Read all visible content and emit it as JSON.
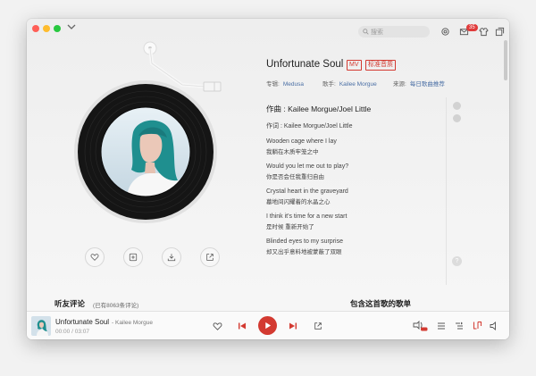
{
  "toolbar": {
    "search_placeholder": "搜索",
    "message_badge": "35"
  },
  "song": {
    "title": "Unfortunate Soul",
    "tag_mv": "MV",
    "tag_quality": "标准音质",
    "album_label": "专辑:",
    "album_value": "Medusa",
    "artist_label": "歌手:",
    "artist_value": "Kailee Morgue",
    "source_label": "来源:",
    "source_value": "每日歌曲推荐"
  },
  "lyrics": {
    "composer": "作曲 : Kailee Morgue/Joel Little",
    "lyricist": "作词 : Kailee Morgue/Joel Little",
    "lines": [
      {
        "en": "Wooden cage where I lay",
        "zh": "我躺在木质牢笼之中"
      },
      {
        "en": "Would you let me out to play?",
        "zh": "你是否会任我重归自由"
      },
      {
        "en": "Crystal heart in the graveyard",
        "zh": "墓地间闪耀着的水晶之心"
      },
      {
        "en": "I think it's time for a new start",
        "zh": "是时候 重新开始了"
      },
      {
        "en": "Blinded eyes to my surprise",
        "zh": "却又出乎意料地被蒙蔽了双眼"
      }
    ]
  },
  "sections": {
    "comments_title": "听友评论",
    "comments_count": "(已有8063条评论)",
    "playlists_title": "包含这首歌的歌单"
  },
  "player": {
    "title": "Unfortunate Soul",
    "artist": "- Kailee Morgue",
    "time_current": "00:00",
    "time_separator": "/",
    "time_total": "03:07"
  },
  "icons": {
    "actions": [
      "heart-icon",
      "add-to-playlist-icon",
      "download-icon",
      "share-icon"
    ],
    "player_left": [
      "heart-icon",
      "prev-icon",
      "play-icon",
      "next-icon",
      "share-icon"
    ],
    "player_right": [
      "effects-icon",
      "playlist-icon",
      "queue-icon",
      "lyric-icon",
      "volume-icon"
    ]
  },
  "colors": {
    "accent": "#d33a31",
    "link": "#4a6fa5",
    "background": "#f2f2f2"
  }
}
